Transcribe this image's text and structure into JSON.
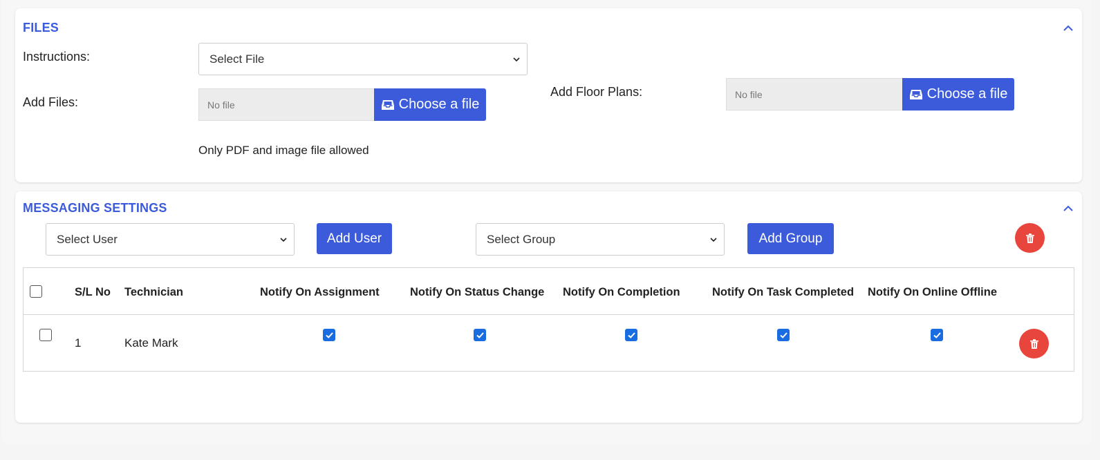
{
  "files": {
    "title": "FILES",
    "instructions_label": "Instructions:",
    "instructions_select": "Select File",
    "add_files_label": "Add Files:",
    "add_files_value": "No file",
    "choose_label": "Choose a file",
    "hint": "Only PDF and image file allowed",
    "floor_plans_label": "Add Floor Plans:",
    "floor_plans_value": "No file"
  },
  "messaging": {
    "title": "MESSAGING SETTINGS",
    "select_user": "Select User",
    "add_user": "Add User",
    "select_group": "Select Group",
    "add_group": "Add Group",
    "columns": [
      "S/L No",
      "Technician",
      "Notify On Assignment",
      "Notify On Status Change",
      "Notify On Completion",
      "Notify On Task Completed",
      "Notify On Online Offline"
    ],
    "rows": [
      {
        "sl": "1",
        "technician": "Kate Mark",
        "notify_assignment": true,
        "notify_status_change": true,
        "notify_completion": true,
        "notify_task_completed": true,
        "notify_online_offline": true
      }
    ]
  },
  "colors": {
    "accent": "#3b5bdb",
    "danger": "#e8453c",
    "checkbox": "#1a6de0"
  }
}
